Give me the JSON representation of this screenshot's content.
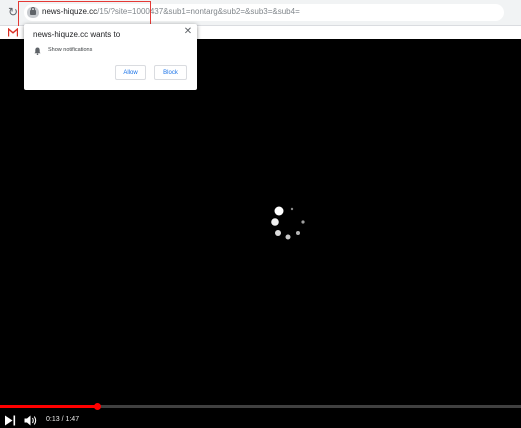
{
  "browser": {
    "url_domain": "news-hiquze.cc",
    "url_rest": "/15/?site=1000437&sub1=nontarg&sub2=&sub3=&sub4=",
    "reload_icon": "reload-icon",
    "lock_icon": "lock-icon",
    "bookmark_icon": "gmail-icon",
    "highlight_color": "#e53935"
  },
  "popup": {
    "title": "news-hiquze.cc wants to",
    "permission_label": "Show notifications",
    "permission_icon": "bell-icon",
    "allow_label": "Allow",
    "block_label": "Block",
    "close_icon": "close-icon",
    "close_glyph": "✕",
    "accent": "#1a73e8"
  },
  "player": {
    "time_display": "0:13 / 1:47",
    "progress_fraction": 0.187,
    "progress_color": "#ff0000",
    "spinner_icon": "loading-spinner-icon",
    "play_icon": "play-icon",
    "volume_icon": "volume-icon"
  }
}
